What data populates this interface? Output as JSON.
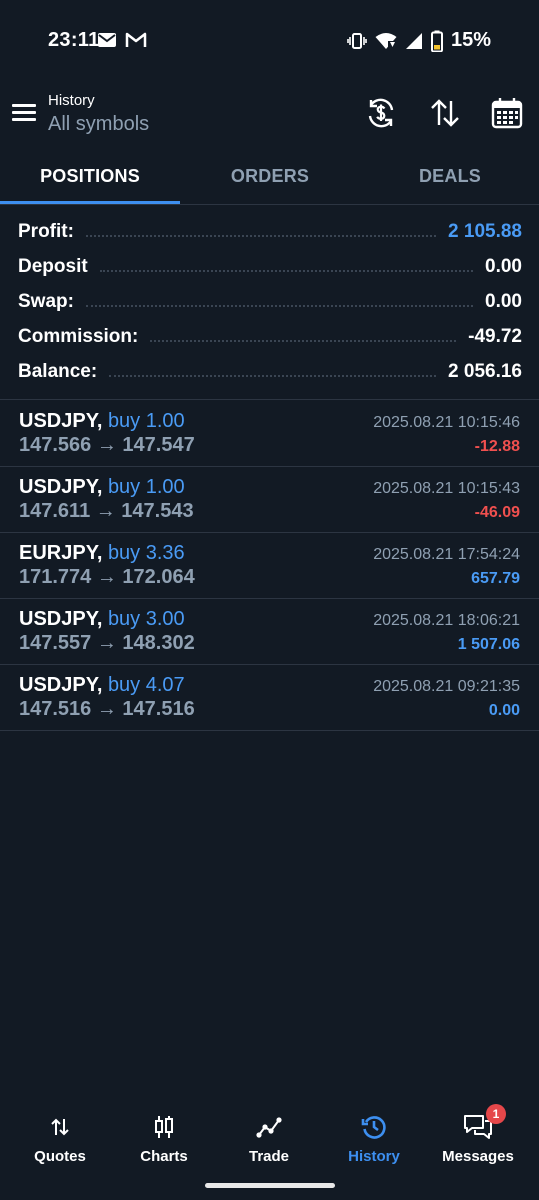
{
  "status_bar": {
    "time": "23:11",
    "battery": "15%",
    "icons": [
      "mail-icon",
      "gmail-icon",
      "vibrate-icon",
      "wifi-icon",
      "signal-icon",
      "battery-icon"
    ]
  },
  "header": {
    "title": "History",
    "subtitle": "All symbols",
    "icons": [
      "currency-refresh-icon",
      "sort-icon",
      "calendar-icon"
    ]
  },
  "tabs": [
    {
      "label": "POSITIONS",
      "active": true
    },
    {
      "label": "ORDERS",
      "active": false
    },
    {
      "label": "DEALS",
      "active": false
    }
  ],
  "summary": {
    "profit_label": "Profit:",
    "profit": "2 105.88",
    "deposit_label": "Deposit",
    "deposit": "0.00",
    "swap_label": "Swap:",
    "swap": "0.00",
    "commission_label": "Commission:",
    "commission": "-49.72",
    "balance_label": "Balance:",
    "balance": "2 056.16"
  },
  "deals": [
    {
      "symbol": "USDJPY,",
      "side": "buy 1.00",
      "prices": "147.566 → 147.547",
      "time": "2025.08.21 10:15:46",
      "profit": "-12.88",
      "sign": "neg"
    },
    {
      "symbol": "USDJPY,",
      "side": "buy 1.00",
      "prices": "147.611 → 147.543",
      "time": "2025.08.21 10:15:43",
      "profit": "-46.09",
      "sign": "neg"
    },
    {
      "symbol": "EURJPY,",
      "side": "buy 3.36",
      "prices": "171.774 → 172.064",
      "time": "2025.08.21 17:54:24",
      "profit": "657.79",
      "sign": "pos"
    },
    {
      "symbol": "USDJPY,",
      "side": "buy 3.00",
      "prices": "147.557 → 148.302",
      "time": "2025.08.21 18:06:21",
      "profit": "1 507.06",
      "sign": "pos"
    },
    {
      "symbol": "USDJPY,",
      "side": "buy 4.07",
      "prices": "147.516 → 147.516",
      "time": "2025.08.21 09:21:35",
      "profit": "0.00",
      "sign": "pos"
    }
  ],
  "bottom_nav": {
    "quotes": "Quotes",
    "charts": "Charts",
    "trade": "Trade",
    "history": "History",
    "messages": "Messages",
    "messages_badge": "1",
    "active": "History"
  },
  "colors": {
    "background": "#121a24",
    "accent": "#3d8ff0",
    "positive": "#4a9bf5",
    "negative": "#f0504f",
    "muted": "#8fa0b2"
  }
}
